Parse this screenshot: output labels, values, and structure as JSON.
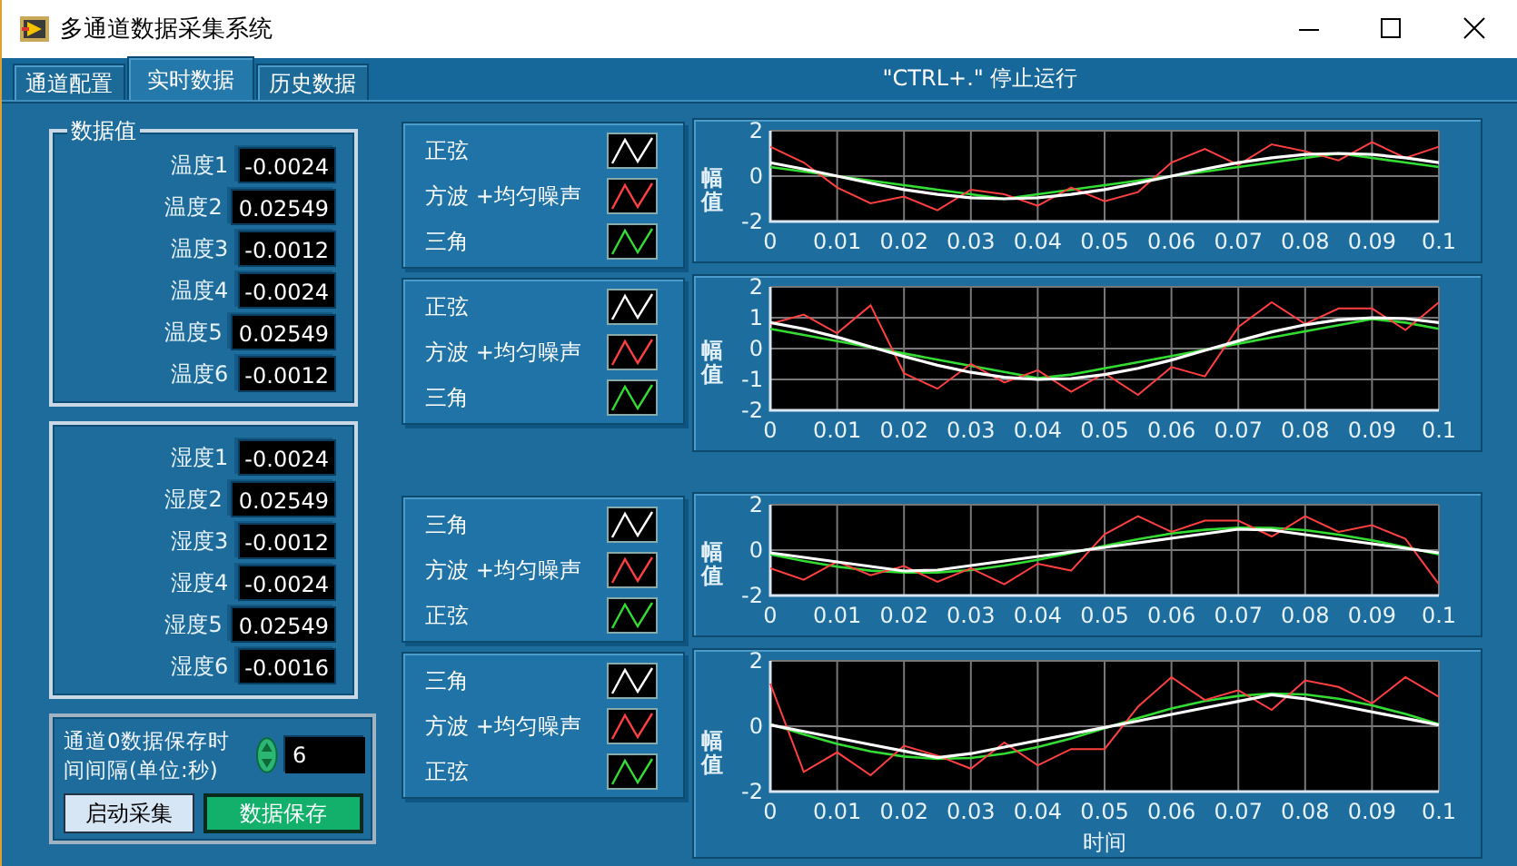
{
  "window": {
    "title": "多通道数据采集系统"
  },
  "tabs": [
    {
      "label": "通道配置",
      "selected": false
    },
    {
      "label": "实时数据",
      "selected": true
    },
    {
      "label": "历史数据",
      "selected": false
    }
  ],
  "hint": "\"CTRL+.\" 停止运行",
  "temperature_group": {
    "title": "数据值",
    "readings": [
      {
        "label": "温度1",
        "value": "-0.0024"
      },
      {
        "label": "温度2",
        "value": "0.02549"
      },
      {
        "label": "温度3",
        "value": "-0.0012"
      },
      {
        "label": "温度4",
        "value": "-0.0024"
      },
      {
        "label": "温度5",
        "value": "0.02549"
      },
      {
        "label": "温度6",
        "value": "-0.0012"
      }
    ]
  },
  "humidity_group": {
    "readings": [
      {
        "label": "湿度1",
        "value": "-0.0024"
      },
      {
        "label": "湿度2",
        "value": "0.02549"
      },
      {
        "label": "湿度3",
        "value": "-0.0012"
      },
      {
        "label": "湿度4",
        "value": "-0.0024"
      },
      {
        "label": "湿度5",
        "value": "0.02549"
      },
      {
        "label": "湿度6",
        "value": "-0.0016"
      }
    ]
  },
  "save_settings": {
    "label": "通道0数据保存时间间隔(单位:秒)",
    "interval": "6",
    "buttons": [
      {
        "label": "启动采集",
        "kind": "default"
      },
      {
        "label": "数据保存",
        "kind": "accent"
      }
    ]
  },
  "charts": [
    {
      "chart_data": {
        "type": "line",
        "grid": true,
        "ylabel": "幅值",
        "xlim": [
          0,
          0.1
        ],
        "ylim": [
          -2,
          2
        ],
        "xticks": [
          0,
          0.01,
          0.02,
          0.03,
          0.04,
          0.05,
          0.06,
          0.07,
          0.08,
          0.09,
          0.1
        ],
        "yticks": [
          -2,
          0,
          2
        ],
        "x": [
          0,
          0.005,
          0.01,
          0.015,
          0.02,
          0.025,
          0.03,
          0.035,
          0.04,
          0.045,
          0.05,
          0.055,
          0.06,
          0.065,
          0.07,
          0.075,
          0.08,
          0.085,
          0.09,
          0.095,
          0.1
        ],
        "series": [
          {
            "name": "正弦",
            "color": "#ffffff",
            "values": [
              0.59,
              0.31,
              0,
              -0.31,
              -0.59,
              -0.81,
              -0.95,
              -1,
              -0.95,
              -0.81,
              -0.59,
              -0.31,
              0,
              0.31,
              0.59,
              0.81,
              0.95,
              1,
              0.95,
              0.81,
              0.59
            ]
          },
          {
            "name": "方波 +均匀噪声",
            "color": "#ff4040",
            "values": [
              1.3,
              0.6,
              -0.5,
              -1.2,
              -0.9,
              -1.5,
              -0.6,
              -0.8,
              -1.3,
              -0.5,
              -1.1,
              -0.7,
              0.6,
              1.2,
              0.5,
              1.4,
              1.1,
              0.7,
              1.5,
              0.8,
              1.3
            ]
          },
          {
            "name": "三角",
            "color": "#33dd33",
            "values": [
              0.4,
              0.2,
              0,
              -0.2,
              -0.4,
              -0.6,
              -0.8,
              -1,
              -0.8,
              -0.6,
              -0.4,
              -0.2,
              0,
              0.2,
              0.4,
              0.6,
              0.8,
              1,
              0.8,
              0.6,
              0.4
            ]
          }
        ]
      }
    },
    {
      "chart_data": {
        "type": "line",
        "grid": true,
        "ylabel": "幅值",
        "xlim": [
          0,
          0.1
        ],
        "ylim": [
          -2,
          2
        ],
        "xticks": [
          0,
          0.01,
          0.02,
          0.03,
          0.04,
          0.05,
          0.06,
          0.07,
          0.08,
          0.09,
          0.1
        ],
        "yticks": [
          -2,
          -1,
          0,
          1,
          2
        ],
        "x": [
          0,
          0.005,
          0.01,
          0.015,
          0.02,
          0.025,
          0.03,
          0.035,
          0.04,
          0.045,
          0.05,
          0.055,
          0.06,
          0.065,
          0.07,
          0.075,
          0.08,
          0.085,
          0.09,
          0.095,
          0.1
        ],
        "series": [
          {
            "name": "正弦",
            "color": "#ffffff",
            "values": [
              0.84,
              0.64,
              0.37,
              0.06,
              -0.25,
              -0.54,
              -0.77,
              -0.93,
              -1,
              -0.97,
              -0.84,
              -0.64,
              -0.37,
              -0.06,
              0.25,
              0.54,
              0.77,
              0.93,
              1,
              0.97,
              0.84
            ]
          },
          {
            "name": "方波 +均匀噪声",
            "color": "#ff4040",
            "values": [
              0.8,
              1.1,
              0.5,
              1.4,
              -0.8,
              -1.3,
              -0.5,
              -1.1,
              -0.7,
              -1.4,
              -0.8,
              -1.5,
              -0.6,
              -0.9,
              0.7,
              1.5,
              0.8,
              1.3,
              1.3,
              0.6,
              1.5
            ]
          },
          {
            "name": "三角",
            "color": "#33dd33",
            "values": [
              0.64,
              0.44,
              0.24,
              0.04,
              -0.16,
              -0.36,
              -0.56,
              -0.76,
              -0.96,
              -0.84,
              -0.64,
              -0.44,
              -0.24,
              -0.04,
              0.16,
              0.36,
              0.56,
              0.76,
              0.96,
              0.84,
              0.64
            ]
          }
        ]
      }
    },
    {
      "chart_data": {
        "type": "line",
        "grid": true,
        "ylabel": "幅值",
        "xlim": [
          0,
          0.1
        ],
        "ylim": [
          -2,
          2
        ],
        "xticks": [
          0,
          0.01,
          0.02,
          0.03,
          0.04,
          0.05,
          0.06,
          0.07,
          0.08,
          0.09,
          0.1
        ],
        "yticks": [
          -2,
          0,
          2
        ],
        "x": [
          0,
          0.005,
          0.01,
          0.015,
          0.02,
          0.025,
          0.03,
          0.035,
          0.04,
          0.045,
          0.05,
          0.055,
          0.06,
          0.065,
          0.07,
          0.075,
          0.08,
          0.085,
          0.09,
          0.095,
          0.1
        ],
        "series": [
          {
            "name": "三角",
            "color": "#ffffff",
            "values": [
              -0.12,
              -0.32,
              -0.52,
              -0.72,
              -0.92,
              -0.88,
              -0.68,
              -0.48,
              -0.28,
              -0.08,
              0.12,
              0.32,
              0.52,
              0.72,
              0.92,
              0.88,
              0.68,
              0.48,
              0.28,
              0.08,
              -0.12
            ]
          },
          {
            "name": "方波 +均匀噪声",
            "color": "#ff4040",
            "values": [
              -0.8,
              -1.3,
              -0.5,
              -1.1,
              -0.7,
              -1.4,
              -0.8,
              -1.5,
              -0.6,
              -0.9,
              0.7,
              1.5,
              0.8,
              1.3,
              1.3,
              0.6,
              1.5,
              0.8,
              1.1,
              0.5,
              -1.5
            ]
          },
          {
            "name": "正弦",
            "color": "#33dd33",
            "values": [
              -0.19,
              -0.48,
              -0.73,
              -0.9,
              -0.99,
              -0.98,
              -0.88,
              -0.68,
              -0.43,
              -0.13,
              0.19,
              0.48,
              0.73,
              0.9,
              0.99,
              0.98,
              0.88,
              0.68,
              0.43,
              0.13,
              -0.19
            ]
          }
        ]
      }
    },
    {
      "chart_data": {
        "type": "line",
        "grid": true,
        "xlabel": "时间",
        "ylabel": "幅值",
        "xlim": [
          0,
          0.1
        ],
        "ylim": [
          -2,
          2
        ],
        "xticks": [
          0,
          0.01,
          0.02,
          0.03,
          0.04,
          0.05,
          0.06,
          0.07,
          0.08,
          0.09,
          0.1
        ],
        "yticks": [
          -2,
          0,
          2
        ],
        "x": [
          0,
          0.005,
          0.01,
          0.015,
          0.02,
          0.025,
          0.03,
          0.035,
          0.04,
          0.045,
          0.05,
          0.055,
          0.06,
          0.065,
          0.07,
          0.075,
          0.08,
          0.085,
          0.09,
          0.095,
          0.1
        ],
        "series": [
          {
            "name": "三角",
            "color": "#ffffff",
            "values": [
              0.04,
              -0.16,
              -0.36,
              -0.56,
              -0.76,
              -0.96,
              -0.84,
              -0.64,
              -0.44,
              -0.24,
              -0.04,
              0.16,
              0.36,
              0.56,
              0.76,
              0.96,
              0.84,
              0.64,
              0.44,
              0.24,
              0.04
            ]
          },
          {
            "name": "方波 +均匀噪声",
            "color": "#ff4040",
            "values": [
              1.3,
              -1.4,
              -0.8,
              -1.5,
              -0.6,
              -0.9,
              -1.3,
              -0.5,
              -1.2,
              -0.7,
              -0.7,
              0.6,
              1.5,
              0.8,
              1.1,
              0.5,
              1.4,
              1.2,
              0.7,
              1.5,
              0.9
            ]
          },
          {
            "name": "正弦",
            "color": "#33dd33",
            "values": [
              0.06,
              -0.25,
              -0.54,
              -0.77,
              -0.93,
              -1,
              -0.97,
              -0.84,
              -0.64,
              -0.37,
              -0.06,
              0.25,
              0.54,
              0.77,
              0.93,
              1,
              0.97,
              0.84,
              0.64,
              0.37,
              0.06
            ]
          }
        ]
      }
    }
  ]
}
